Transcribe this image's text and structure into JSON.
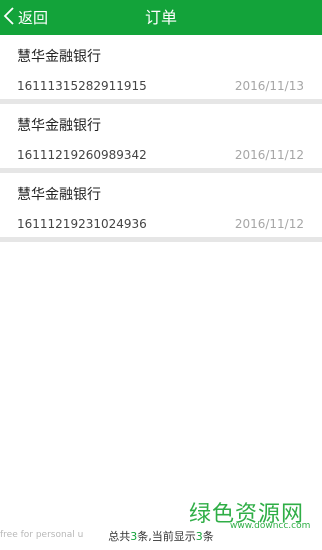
{
  "header": {
    "back_label": "返回",
    "title": "订单",
    "color": "#13a33a"
  },
  "orders": [
    {
      "bank": "慧华金融银行",
      "number": "16111315282911915",
      "date": "2016/11/13"
    },
    {
      "bank": "慧华金融银行",
      "number": "16111219260989342",
      "date": "2016/11/12"
    },
    {
      "bank": "慧华金融银行",
      "number": "16111219231024936",
      "date": "2016/11/12"
    }
  ],
  "footer": {
    "prefix": "总共",
    "total": "3",
    "middle": "条,当前显示",
    "shown": "3",
    "suffix": "条",
    "left_text": "free for personal u"
  },
  "watermark": {
    "logo": "绿色资源网",
    "url": "www.downcc.com"
  }
}
